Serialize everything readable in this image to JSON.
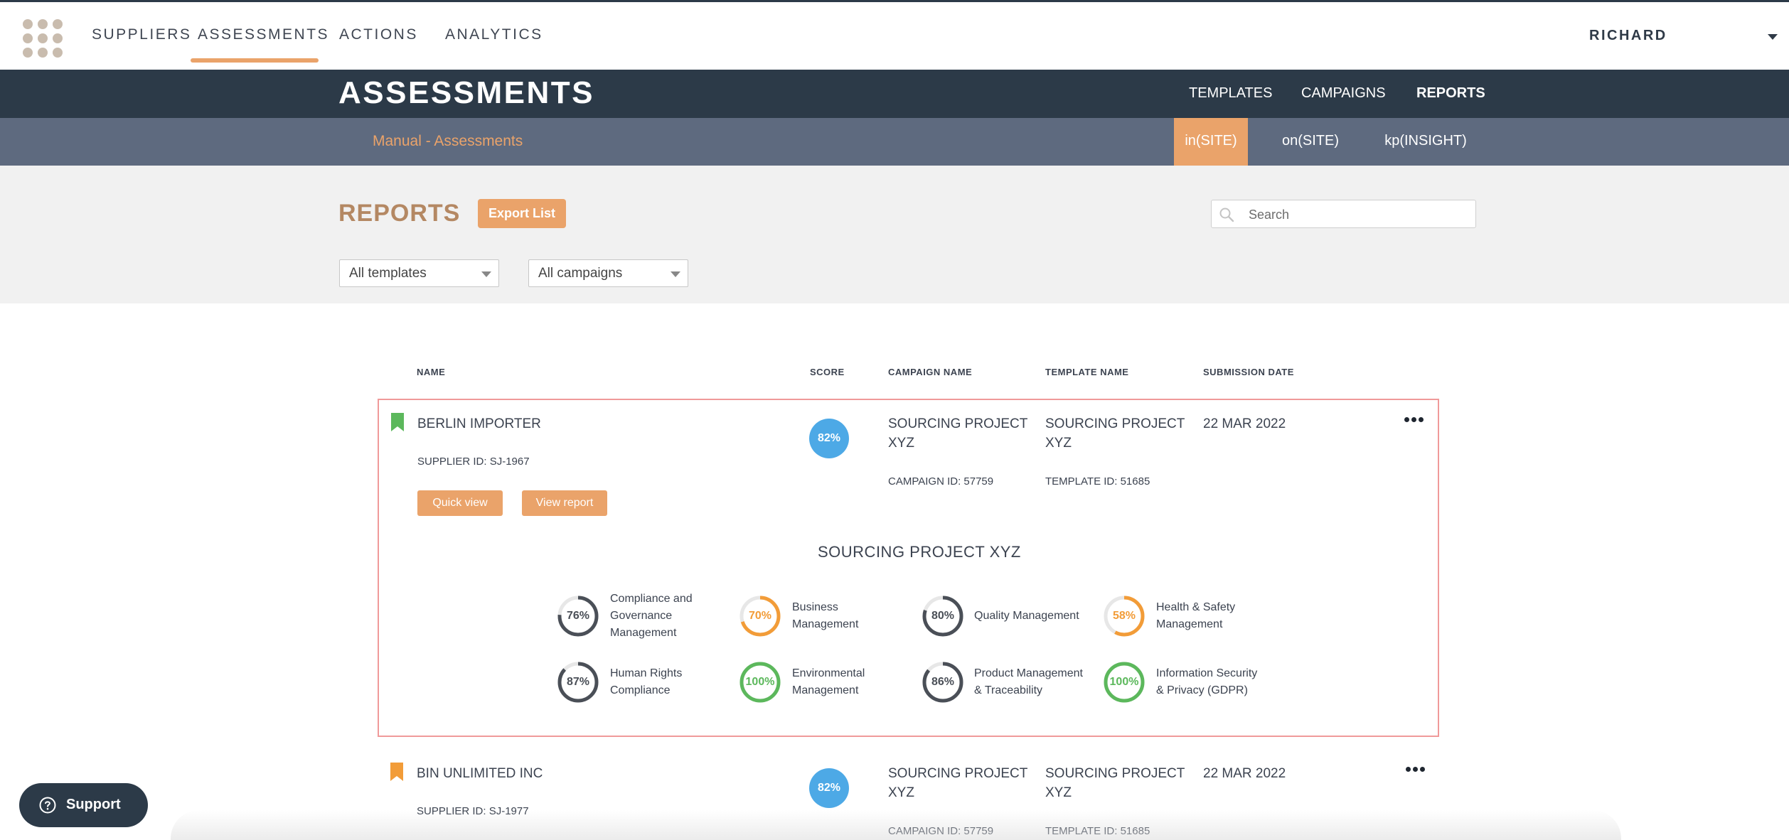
{
  "topnav": {
    "items": [
      "SUPPLIERS",
      "ASSESSMENTS",
      "ACTIONS",
      "ANALYTICS"
    ],
    "active": "ASSESSMENTS",
    "user": "RICHARD"
  },
  "header": {
    "title": "ASSESSMENTS",
    "links": [
      "TEMPLATES",
      "CAMPAIGNS",
      "REPORTS"
    ],
    "active_link": "REPORTS"
  },
  "subheader": {
    "label": "Manual - Assessments",
    "tabs": [
      "in(SITE)",
      "on(SITE)",
      "kp(INSIGHT)"
    ],
    "active_tab": "in(SITE)"
  },
  "reports": {
    "title": "REPORTS",
    "export_label": "Export List",
    "search_placeholder": "Search",
    "template_filter": "All templates",
    "campaign_filter": "All campaigns"
  },
  "columns": [
    "NAME",
    "SCORE",
    "CAMPAIGN NAME",
    "TEMPLATE NAME",
    "SUBMISSION DATE"
  ],
  "rows": [
    {
      "name": "BERLIN IMPORTER",
      "supplier_id": "SUPPLIER ID: SJ-1967",
      "score": "82%",
      "campaign_name": "SOURCING PROJECT XYZ",
      "campaign_id": "CAMPAIGN ID: 57759",
      "template_name": "SOURCING PROJECT XYZ",
      "template_id": "TEMPLATE ID: 51685",
      "date": "22 MAR 2022",
      "quick_view": "Quick view",
      "view_report": "View report",
      "bookmark_color": "#5cb85c"
    },
    {
      "name": "BIN UNLIMITED INC",
      "supplier_id": "SUPPLIER ID: SJ-1977",
      "score": "82%",
      "campaign_name": "SOURCING PROJECT XYZ",
      "campaign_id": "CAMPAIGN ID: 57759",
      "template_name": "SOURCING PROJECT XYZ",
      "template_id": "TEMPLATE ID: 51685",
      "date": "22 MAR 2022",
      "bookmark_color": "#f29c38"
    }
  ],
  "expanded": {
    "title": "SOURCING PROJECT XYZ",
    "metrics": [
      {
        "value": "76%",
        "pct": 76,
        "label": "Compliance and Governance Management",
        "color": "#4a4f57"
      },
      {
        "value": "70%",
        "pct": 70,
        "label": "Business Management",
        "color": "#f29c38"
      },
      {
        "value": "80%",
        "pct": 80,
        "label": "Quality Management",
        "color": "#4a4f57"
      },
      {
        "value": "58%",
        "pct": 58,
        "label": "Health & Safety Management",
        "color": "#f29c38"
      },
      {
        "value": "87%",
        "pct": 87,
        "label": "Human Rights Compliance",
        "color": "#4a4f57"
      },
      {
        "value": "100%",
        "pct": 100,
        "label": "Environmental Management",
        "color": "#5cb85c"
      },
      {
        "value": "86%",
        "pct": 86,
        "label": "Product Management & Traceability",
        "color": "#4a4f57"
      },
      {
        "value": "100%",
        "pct": 100,
        "label": "Information Security & Privacy (GDPR)",
        "color": "#5cb85c"
      }
    ]
  },
  "support_label": "Support",
  "colors": {
    "accent": "#eaa36a",
    "navy": "#2c3a48",
    "slate": "#5e6a7f",
    "score": "#4da9e6"
  }
}
